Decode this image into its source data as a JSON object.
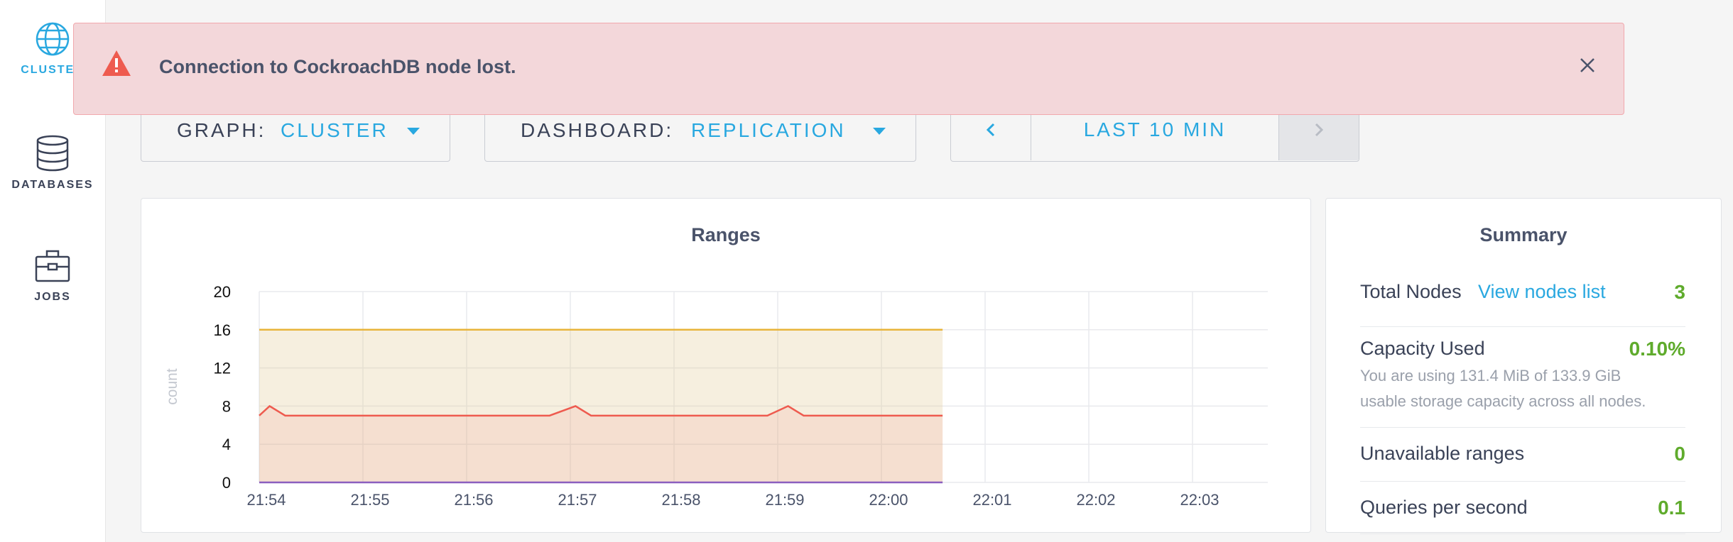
{
  "sidebar": {
    "items": [
      {
        "label": "CLUSTER",
        "icon": "globe-icon",
        "active": true
      },
      {
        "label": "DATABASES",
        "icon": "database-icon",
        "active": false
      },
      {
        "label": "JOBS",
        "icon": "briefcase-icon",
        "active": false
      }
    ]
  },
  "alert": {
    "message": "Connection to CockroachDB node lost.",
    "icon": "warning-icon",
    "close_icon": "close-icon"
  },
  "toolbar": {
    "graph": {
      "label": "GRAPH:",
      "value": "CLUSTER"
    },
    "dashboard": {
      "label": "DASHBOARD:",
      "value": "REPLICATION"
    },
    "time": {
      "range": "LAST 10 MIN"
    }
  },
  "chart": {
    "title": "Ranges",
    "ylabel": "count"
  },
  "chart_data": {
    "type": "area",
    "title": "Ranges",
    "ylabel": "count",
    "xlabel": "",
    "ylim": [
      0,
      20
    ],
    "yticks": [
      0,
      4,
      8,
      12,
      16,
      20
    ],
    "xticks": [
      "21:54",
      "21:55",
      "21:56",
      "21:57",
      "21:58",
      "21:59",
      "22:00",
      "22:01",
      "22:02",
      "22:03"
    ],
    "series": [
      {
        "color": "#e8b43a",
        "points": [
          [
            0,
            16
          ],
          [
            1,
            16
          ],
          [
            2,
            16
          ],
          [
            3,
            16
          ],
          [
            4,
            16
          ],
          [
            5,
            16
          ],
          [
            6,
            16
          ],
          [
            6.59,
            16
          ]
        ]
      },
      {
        "color": "#ee5b4f",
        "points": [
          [
            0,
            7
          ],
          [
            0.1,
            8
          ],
          [
            0.25,
            7
          ],
          [
            2.8,
            7
          ],
          [
            3.05,
            8
          ],
          [
            3.2,
            7
          ],
          [
            4.9,
            7
          ],
          [
            5.1,
            8
          ],
          [
            5.25,
            7
          ],
          [
            6.59,
            7
          ]
        ]
      },
      {
        "color": "#8b5fbf",
        "points": [
          [
            0,
            0
          ],
          [
            6.59,
            0
          ]
        ]
      }
    ],
    "grid": true
  },
  "summary": {
    "title": "Summary",
    "total_nodes": {
      "label": "Total Nodes",
      "link": "View nodes list",
      "value": "3"
    },
    "capacity": {
      "label": "Capacity Used",
      "value": "0.10%",
      "desc_line1": "You are using 131.4 MiB of 133.9 GiB",
      "desc_line2": "usable storage capacity across all nodes."
    },
    "unavailable": {
      "label": "Unavailable ranges",
      "value": "0"
    },
    "qps": {
      "label": "Queries per second",
      "value": "0.1"
    }
  },
  "colors": {
    "accent": "#29a8e0",
    "alert_bg": "#f3d7da",
    "good": "#5fab2c"
  }
}
